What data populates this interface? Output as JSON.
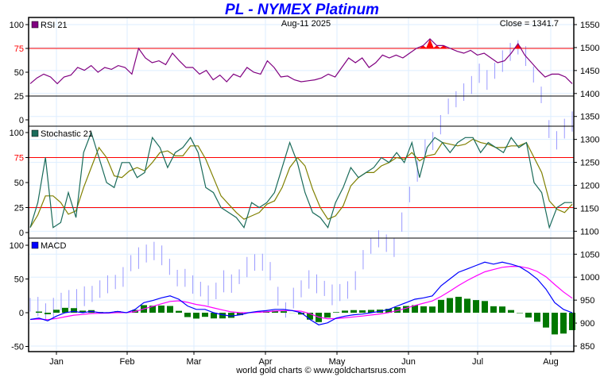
{
  "title": "PL  -  NYMEX Platinum",
  "date_label": "Aug-11  2025",
  "close_label": "Close = 1341.7",
  "footer": "world gold charts © www.goldchartsrus.com",
  "colors": {
    "title": "#0000ff",
    "rsi": "#800080",
    "stoch_k": "#1a6b5a",
    "stoch_d": "#808000",
    "macd": "#0000ff",
    "signal": "#ff00ff",
    "hist": "#007700",
    "price": "#9999ff",
    "ref": "#ff0000"
  },
  "chart_data": [
    {
      "type": "line",
      "name": "RSI 21",
      "ylim": [
        0,
        100
      ],
      "yticks": [
        "100",
        "75",
        "50",
        "25",
        "0"
      ],
      "ref_lines": [
        75,
        25
      ],
      "values": [
        38,
        44,
        48,
        45,
        38,
        45,
        47,
        55,
        52,
        57,
        50,
        55,
        53,
        57,
        55,
        48,
        75,
        65,
        60,
        62,
        58,
        70,
        62,
        55,
        55,
        48,
        52,
        42,
        47,
        40,
        48,
        45,
        55,
        50,
        48,
        62,
        55,
        45,
        46,
        42,
        40,
        41,
        42,
        44,
        48,
        45,
        55,
        65,
        60,
        65,
        55,
        60,
        68,
        65,
        68,
        65,
        70,
        75,
        78,
        85,
        78,
        78,
        75,
        72,
        70,
        73,
        68,
        70,
        65,
        60,
        62,
        70,
        80,
        68,
        60,
        52,
        45,
        48,
        48,
        45,
        38
      ]
    },
    {
      "type": "line",
      "name": "Stochastic 21",
      "ylim": [
        0,
        100
      ],
      "yticks": [
        "100",
        "75",
        "50",
        "25",
        "0"
      ],
      "ref_lines": [
        75,
        25
      ],
      "d_smoothing": 3,
      "k": [
        5,
        30,
        75,
        5,
        10,
        40,
        15,
        80,
        100,
        75,
        50,
        45,
        70,
        70,
        55,
        60,
        95,
        85,
        65,
        80,
        85,
        95,
        80,
        45,
        40,
        25,
        20,
        15,
        5,
        30,
        25,
        30,
        40,
        65,
        90,
        70,
        40,
        20,
        15,
        5,
        30,
        45,
        65,
        55,
        60,
        65,
        75,
        70,
        80,
        70,
        90,
        55,
        85,
        95,
        90,
        80,
        90,
        95,
        95,
        80,
        90,
        85,
        80,
        95,
        85,
        90,
        50,
        40,
        5,
        25,
        30,
        30
      ]
    },
    {
      "type": "line",
      "name": "MACD",
      "ylim": [
        -50,
        100
      ],
      "yticks": [
        "100",
        "50",
        "0",
        "-50"
      ],
      "macd": [
        -10,
        -8,
        -12,
        -5,
        0,
        2,
        0,
        2,
        0,
        0,
        2,
        0,
        5,
        15,
        18,
        22,
        25,
        20,
        10,
        5,
        5,
        0,
        -3,
        -5,
        -3,
        0,
        2,
        3,
        5,
        5,
        3,
        0,
        -10,
        -18,
        -15,
        -8,
        -5,
        -3,
        -2,
        0,
        2,
        5,
        10,
        15,
        20,
        22,
        25,
        40,
        50,
        60,
        65,
        70,
        75,
        72,
        75,
        72,
        68,
        60,
        50,
        35,
        15,
        5,
        0
      ]
    },
    {
      "type": "bar",
      "name": "Price",
      "axis": "right",
      "ylim": [
        850,
        1550
      ],
      "yticks": [
        "1550",
        "1500",
        "1450",
        "1400",
        "1350",
        "1300",
        "1250",
        "1200",
        "1150",
        "1100",
        "1050",
        "1000",
        "950",
        "900",
        "850"
      ],
      "closes": [
        940,
        935,
        925,
        930,
        945,
        955,
        950,
        960,
        965,
        970,
        985,
        990,
        1000,
        1030,
        1040,
        1050,
        1060,
        1045,
        1020,
        1000,
        995,
        985,
        975,
        960,
        970,
        990,
        985,
        1000,
        1020,
        1030,
        1035,
        1010,
        960,
        930,
        955,
        975,
        990,
        985,
        975,
        960,
        965,
        975,
        990,
        1040,
        1070,
        1080,
        1075,
        1060,
        1120,
        1180,
        1230,
        1280,
        1300,
        1330,
        1370,
        1390,
        1400,
        1420,
        1440,
        1430,
        1450,
        1470,
        1490,
        1500,
        1480,
        1440,
        1400,
        1320,
        1300,
        1320,
        1340
      ],
      "range": 30
    },
    {
      "xticks": [
        "Jan",
        "Feb",
        "Mar",
        "Apr",
        "May",
        "Jun",
        "Jul",
        "Aug"
      ]
    }
  ]
}
